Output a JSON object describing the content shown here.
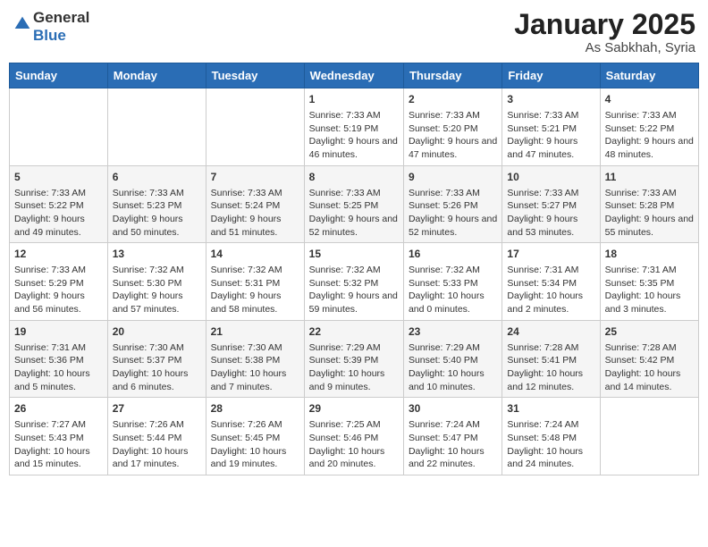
{
  "header": {
    "logo_general": "General",
    "logo_blue": "Blue",
    "month": "January 2025",
    "location": "As Sabkhah, Syria"
  },
  "days_of_week": [
    "Sunday",
    "Monday",
    "Tuesday",
    "Wednesday",
    "Thursday",
    "Friday",
    "Saturday"
  ],
  "weeks": [
    [
      {
        "day": "",
        "info": ""
      },
      {
        "day": "",
        "info": ""
      },
      {
        "day": "",
        "info": ""
      },
      {
        "day": "1",
        "info": "Sunrise: 7:33 AM\nSunset: 5:19 PM\nDaylight: 9 hours and 46 minutes."
      },
      {
        "day": "2",
        "info": "Sunrise: 7:33 AM\nSunset: 5:20 PM\nDaylight: 9 hours and 47 minutes."
      },
      {
        "day": "3",
        "info": "Sunrise: 7:33 AM\nSunset: 5:21 PM\nDaylight: 9 hours and 47 minutes."
      },
      {
        "day": "4",
        "info": "Sunrise: 7:33 AM\nSunset: 5:22 PM\nDaylight: 9 hours and 48 minutes."
      }
    ],
    [
      {
        "day": "5",
        "info": "Sunrise: 7:33 AM\nSunset: 5:22 PM\nDaylight: 9 hours and 49 minutes."
      },
      {
        "day": "6",
        "info": "Sunrise: 7:33 AM\nSunset: 5:23 PM\nDaylight: 9 hours and 50 minutes."
      },
      {
        "day": "7",
        "info": "Sunrise: 7:33 AM\nSunset: 5:24 PM\nDaylight: 9 hours and 51 minutes."
      },
      {
        "day": "8",
        "info": "Sunrise: 7:33 AM\nSunset: 5:25 PM\nDaylight: 9 hours and 52 minutes."
      },
      {
        "day": "9",
        "info": "Sunrise: 7:33 AM\nSunset: 5:26 PM\nDaylight: 9 hours and 52 minutes."
      },
      {
        "day": "10",
        "info": "Sunrise: 7:33 AM\nSunset: 5:27 PM\nDaylight: 9 hours and 53 minutes."
      },
      {
        "day": "11",
        "info": "Sunrise: 7:33 AM\nSunset: 5:28 PM\nDaylight: 9 hours and 55 minutes."
      }
    ],
    [
      {
        "day": "12",
        "info": "Sunrise: 7:33 AM\nSunset: 5:29 PM\nDaylight: 9 hours and 56 minutes."
      },
      {
        "day": "13",
        "info": "Sunrise: 7:32 AM\nSunset: 5:30 PM\nDaylight: 9 hours and 57 minutes."
      },
      {
        "day": "14",
        "info": "Sunrise: 7:32 AM\nSunset: 5:31 PM\nDaylight: 9 hours and 58 minutes."
      },
      {
        "day": "15",
        "info": "Sunrise: 7:32 AM\nSunset: 5:32 PM\nDaylight: 9 hours and 59 minutes."
      },
      {
        "day": "16",
        "info": "Sunrise: 7:32 AM\nSunset: 5:33 PM\nDaylight: 10 hours and 0 minutes."
      },
      {
        "day": "17",
        "info": "Sunrise: 7:31 AM\nSunset: 5:34 PM\nDaylight: 10 hours and 2 minutes."
      },
      {
        "day": "18",
        "info": "Sunrise: 7:31 AM\nSunset: 5:35 PM\nDaylight: 10 hours and 3 minutes."
      }
    ],
    [
      {
        "day": "19",
        "info": "Sunrise: 7:31 AM\nSunset: 5:36 PM\nDaylight: 10 hours and 5 minutes."
      },
      {
        "day": "20",
        "info": "Sunrise: 7:30 AM\nSunset: 5:37 PM\nDaylight: 10 hours and 6 minutes."
      },
      {
        "day": "21",
        "info": "Sunrise: 7:30 AM\nSunset: 5:38 PM\nDaylight: 10 hours and 7 minutes."
      },
      {
        "day": "22",
        "info": "Sunrise: 7:29 AM\nSunset: 5:39 PM\nDaylight: 10 hours and 9 minutes."
      },
      {
        "day": "23",
        "info": "Sunrise: 7:29 AM\nSunset: 5:40 PM\nDaylight: 10 hours and 10 minutes."
      },
      {
        "day": "24",
        "info": "Sunrise: 7:28 AM\nSunset: 5:41 PM\nDaylight: 10 hours and 12 minutes."
      },
      {
        "day": "25",
        "info": "Sunrise: 7:28 AM\nSunset: 5:42 PM\nDaylight: 10 hours and 14 minutes."
      }
    ],
    [
      {
        "day": "26",
        "info": "Sunrise: 7:27 AM\nSunset: 5:43 PM\nDaylight: 10 hours and 15 minutes."
      },
      {
        "day": "27",
        "info": "Sunrise: 7:26 AM\nSunset: 5:44 PM\nDaylight: 10 hours and 17 minutes."
      },
      {
        "day": "28",
        "info": "Sunrise: 7:26 AM\nSunset: 5:45 PM\nDaylight: 10 hours and 19 minutes."
      },
      {
        "day": "29",
        "info": "Sunrise: 7:25 AM\nSunset: 5:46 PM\nDaylight: 10 hours and 20 minutes."
      },
      {
        "day": "30",
        "info": "Sunrise: 7:24 AM\nSunset: 5:47 PM\nDaylight: 10 hours and 22 minutes."
      },
      {
        "day": "31",
        "info": "Sunrise: 7:24 AM\nSunset: 5:48 PM\nDaylight: 10 hours and 24 minutes."
      },
      {
        "day": "",
        "info": ""
      }
    ]
  ]
}
